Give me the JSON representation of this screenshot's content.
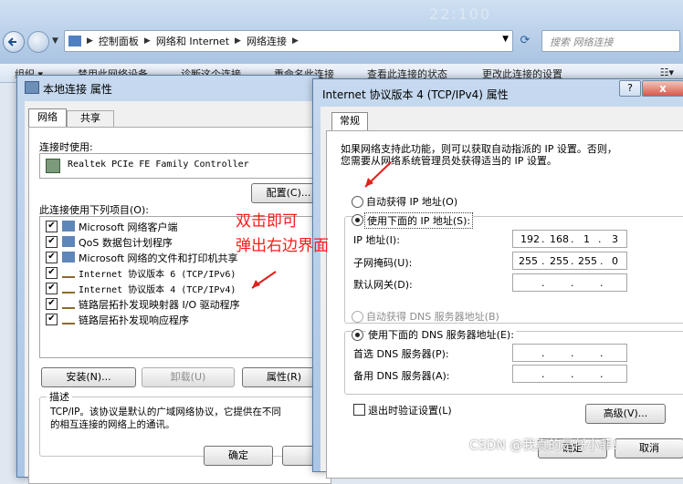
{
  "explorer": {
    "header_art": "22:100",
    "address": {
      "breadcrumbs": [
        "控制面板",
        "网络和 Internet",
        "网络连接"
      ]
    },
    "search_placeholder": "搜索 网络连接",
    "command_bar": [
      "组织 ▾",
      "禁用此网络设备",
      "诊断这个连接",
      "重命名此连接",
      "查看此连接的状态",
      "更改此连接的设置"
    ]
  },
  "local_dialog": {
    "title": "本地连接 属性",
    "tabs": [
      "网络",
      "共享"
    ],
    "connect_using_label": "连接时使用:",
    "adapter": "Realtek PCIe FE Family Controller",
    "configure_button": "配置(C)...",
    "items_label": "此连接使用下列项目(O):",
    "items": [
      {
        "label": "Microsoft 网络客户端",
        "checked": true
      },
      {
        "label": "QoS 数据包计划程序",
        "checked": true
      },
      {
        "label": "Microsoft 网络的文件和打印机共享",
        "checked": true
      },
      {
        "label": "Internet 协议版本 6 (TCP/IPv6)",
        "checked": true
      },
      {
        "label": "Internet 协议版本 4 (TCP/IPv4)",
        "checked": true
      },
      {
        "label": "链路层拓扑发现映射器 I/O 驱动程序",
        "checked": true
      },
      {
        "label": "链路层拓扑发现响应程序",
        "checked": true
      }
    ],
    "install_button": "安装(N)...",
    "uninstall_button": "卸载(U)",
    "properties_button": "属性(R)",
    "description_label": "描述",
    "description_line1": "TCP/IP。该协议是默认的广域网络协议，它提供在不同",
    "description_line2": "的相互连接的网络上的通讯。",
    "ok_button": "确定",
    "cancel_button": "取"
  },
  "ipv4_dialog": {
    "title": "Internet 协议版本 4 (TCP/IPv4) 属性",
    "help_button": "?",
    "close_button": "x",
    "tab": "常规",
    "intro_line1": "如果网络支持此功能，则可以获取自动指派的 IP 设置。否则，",
    "intro_line2": "您需要从网络系统管理员处获得适当的 IP 设置。",
    "auto_ip_option": "自动获得 IP 地址(O)",
    "manual_ip_option": "使用下面的 IP 地址(S):",
    "ip_label": "IP 地址(I):",
    "ip_value": [
      "192",
      "168",
      "1",
      "3"
    ],
    "subnet_label": "子网掩码(U):",
    "subnet_value": [
      "255",
      "255",
      "255",
      "0"
    ],
    "gateway_label": "默认网关(D):",
    "auto_dns_option": "自动获得 DNS 服务器地址(B)",
    "manual_dns_option": "使用下面的 DNS 服务器地址(E):",
    "preferred_dns_label": "首选 DNS 服务器(P):",
    "alternate_dns_label": "备用 DNS 服务器(A):",
    "validate_on_exit": "退出时验证设置(L)",
    "advanced_button": "高级(V)...",
    "ok_button": "确定",
    "cancel_button": "取消"
  },
  "annotation": {
    "line1": "双击即可",
    "line2": "弹出右边界面",
    "color": "#ff1a1a"
  },
  "watermark": "CSDN @我真的是任小菲!"
}
